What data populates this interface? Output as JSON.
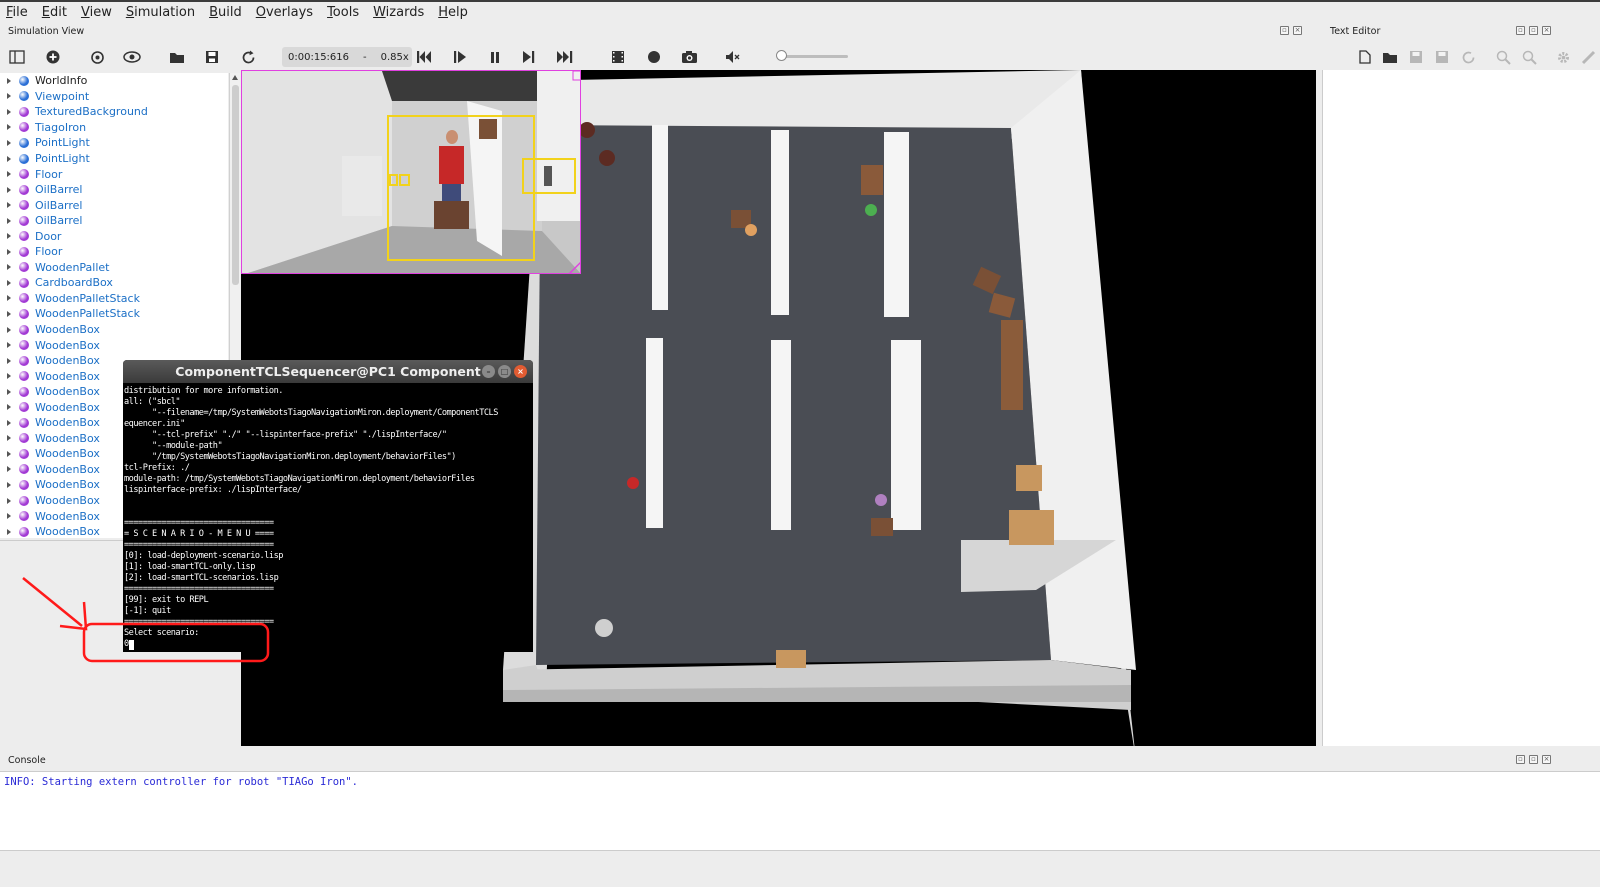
{
  "menu": [
    "File",
    "Edit",
    "View",
    "Simulation",
    "Build",
    "Overlays",
    "Tools",
    "Wizards",
    "Help"
  ],
  "simulation_view": {
    "title": "Simulation View"
  },
  "toolbar": {
    "time": "0:00:15:616",
    "separator": "-",
    "speed": "0.85x",
    "icons": [
      "scene-tree-toggle-icon",
      "add-node-icon",
      "reset-view-icon",
      "visibility-icon",
      "open-world-icon",
      "save-world-icon",
      "reload-world-icon",
      "step-back-icon",
      "step-icon",
      "pause-icon",
      "run-icon",
      "fast-run-icon",
      "record-movie-icon",
      "record-animation-icon",
      "screenshot-icon",
      "mute-icon"
    ]
  },
  "scene_tree": {
    "items": [
      {
        "label": "WorldInfo",
        "color": "#2b6fd6"
      },
      {
        "label": "Viewpoint",
        "color": "#2b6fd6"
      },
      {
        "label": "TexturedBackground",
        "color": "#a23ad4"
      },
      {
        "label": "TiagoIron",
        "color": "#a23ad4"
      },
      {
        "label": "PointLight",
        "color": "#2b6fd6"
      },
      {
        "label": "PointLight",
        "color": "#2b6fd6"
      },
      {
        "label": "Floor",
        "color": "#a23ad4"
      },
      {
        "label": "OilBarrel",
        "color": "#a23ad4"
      },
      {
        "label": "OilBarrel",
        "color": "#a23ad4"
      },
      {
        "label": "OilBarrel",
        "color": "#a23ad4"
      },
      {
        "label": "Door",
        "color": "#a23ad4"
      },
      {
        "label": "Floor",
        "color": "#a23ad4"
      },
      {
        "label": "WoodenPallet",
        "color": "#a23ad4"
      },
      {
        "label": "CardboardBox",
        "color": "#a23ad4"
      },
      {
        "label": "WoodenPalletStack",
        "color": "#a23ad4"
      },
      {
        "label": "WoodenPalletStack",
        "color": "#a23ad4"
      },
      {
        "label": "WoodenBox",
        "color": "#a23ad4"
      },
      {
        "label": "WoodenBox",
        "color": "#a23ad4"
      },
      {
        "label": "WoodenBox",
        "color": "#a23ad4"
      },
      {
        "label": "WoodenBox",
        "color": "#a23ad4"
      },
      {
        "label": "WoodenBox",
        "color": "#a23ad4"
      },
      {
        "label": "WoodenBox",
        "color": "#a23ad4"
      },
      {
        "label": "WoodenBox",
        "color": "#a23ad4"
      },
      {
        "label": "WoodenBox",
        "color": "#a23ad4"
      },
      {
        "label": "WoodenBox",
        "color": "#a23ad4"
      },
      {
        "label": "WoodenBox",
        "color": "#a23ad4"
      },
      {
        "label": "WoodenBox",
        "color": "#a23ad4"
      },
      {
        "label": "WoodenBox",
        "color": "#a23ad4"
      },
      {
        "label": "WoodenBox",
        "color": "#a23ad4"
      },
      {
        "label": "WoodenBox",
        "color": "#a23ad4"
      }
    ]
  },
  "text_editor": {
    "title": "Text Editor"
  },
  "console": {
    "title": "Console",
    "line": "INFO: Starting extern controller for robot \"TIAGo Iron\"."
  },
  "terminal": {
    "title": "ComponentTCLSequencer@PC1 Component",
    "lines": [
      "distribution for more information.",
      "all: (\"sbcl\"",
      "      \"--filename=/tmp/SystemWebotsTiagoNavigationMiron.deployment/ComponentTCLS",
      "equencer.ini\"",
      "      \"--tcl-prefix\" \"./\" \"--lispinterface-prefix\" \"./lispInterface/\"",
      "      \"--module-path\"",
      "      \"/tmp/SystemWebotsTiagoNavigationMiron.deployment/behaviorFiles\")",
      "tcl-Prefix: ./",
      "module-path: /tmp/SystemWebotsTiagoNavigationMiron.deployment/behaviorFiles",
      "lispinterface-prefix: ./lispInterface/",
      "",
      "",
      "================================",
      "= S C E N A R I O - M E N U ====",
      "================================",
      "[0]: load-deployment-scenario.lisp",
      "[1]: load-smartTCL-only.lisp",
      "[2]: load-smartTCL-scenarios.lisp",
      "================================",
      "[99]: exit to REPL",
      "[-1]: quit",
      "================================",
      "Select scenario:"
    ],
    "input": "0"
  },
  "colors": {
    "annotation": "#ff1a1a",
    "overlay_border": "#e040e0",
    "detection_box": "#f2d21b"
  }
}
